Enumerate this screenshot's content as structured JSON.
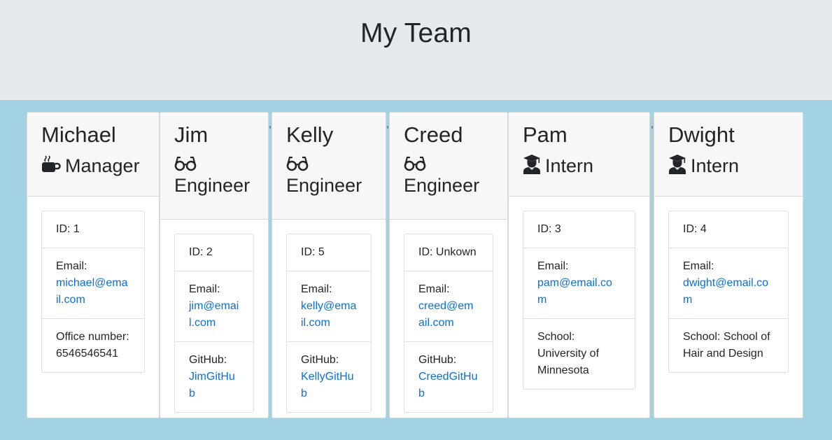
{
  "header": {
    "title": "My Team"
  },
  "team": [
    {
      "name": "Michael",
      "role": "Manager",
      "icon": "coffee-icon",
      "id": "ID: 1",
      "email_label": "Email:",
      "email": "michael@email.com",
      "extra_label": "Office number:",
      "extra_value": "6546546541"
    },
    {
      "name": "Jim",
      "role": "Engineer",
      "icon": "glasses-icon",
      "id": "ID: 2",
      "email_label": "Email:",
      "email": "jim@email.com",
      "extra_label": "GitHub:",
      "extra_value": "JimGitHub"
    },
    {
      "name": "Kelly",
      "role": "Engineer",
      "icon": "glasses-icon",
      "id": "ID: 5",
      "email_label": "Email:",
      "email": "kelly@email.com",
      "extra_label": "GitHub:",
      "extra_value": "KellyGitHub"
    },
    {
      "name": "Creed",
      "role": "Engineer",
      "icon": "glasses-icon",
      "id": "ID: Unkown",
      "email_label": "Email:",
      "email": "creed@email.com",
      "extra_label": "GitHub:",
      "extra_value": "CreedGitHub"
    },
    {
      "name": "Pam",
      "role": "Intern",
      "icon": "graduate-icon",
      "id": "ID: 3",
      "email_label": "Email:",
      "email": "pam@email.com",
      "extra_label": "School:",
      "extra_value": "University of Minnesota"
    },
    {
      "name": "Dwight",
      "role": "Intern",
      "icon": "graduate-icon",
      "id": "ID: 4",
      "email_label": "Email:",
      "email": "dwight@email.com",
      "extra_label": "School:",
      "extra_value": "School of Hair and Design"
    }
  ],
  "separators": [
    ",",
    ",",
    ","
  ]
}
